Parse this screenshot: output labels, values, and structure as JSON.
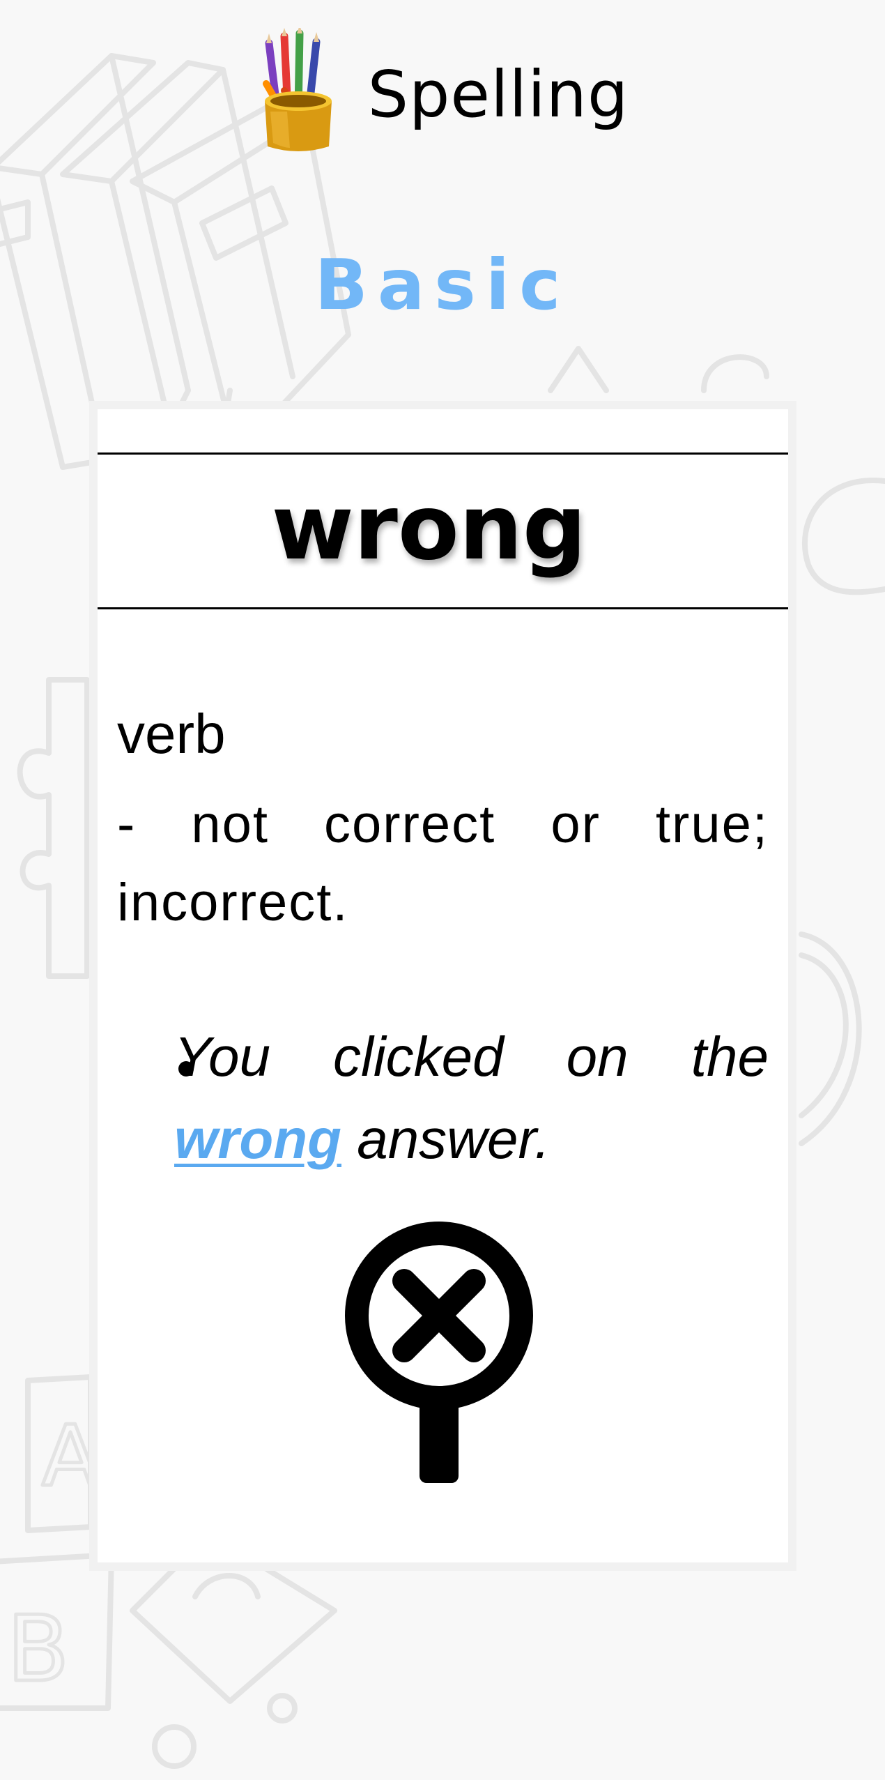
{
  "header": {
    "app_title": "Spelling",
    "app_icon": "pencil-cup-icon"
  },
  "level": {
    "label": "Basic",
    "color": "#72b7f7"
  },
  "card": {
    "word": "wrong",
    "part_of_speech": "verb",
    "definition": " - not correct or true; incorrect.",
    "example": {
      "before": "You clicked on the ",
      "highlight": "wrong",
      "after": " answer."
    },
    "illustration_icon": "magnifier-x-icon",
    "highlight_color": "#5aa9f0"
  }
}
